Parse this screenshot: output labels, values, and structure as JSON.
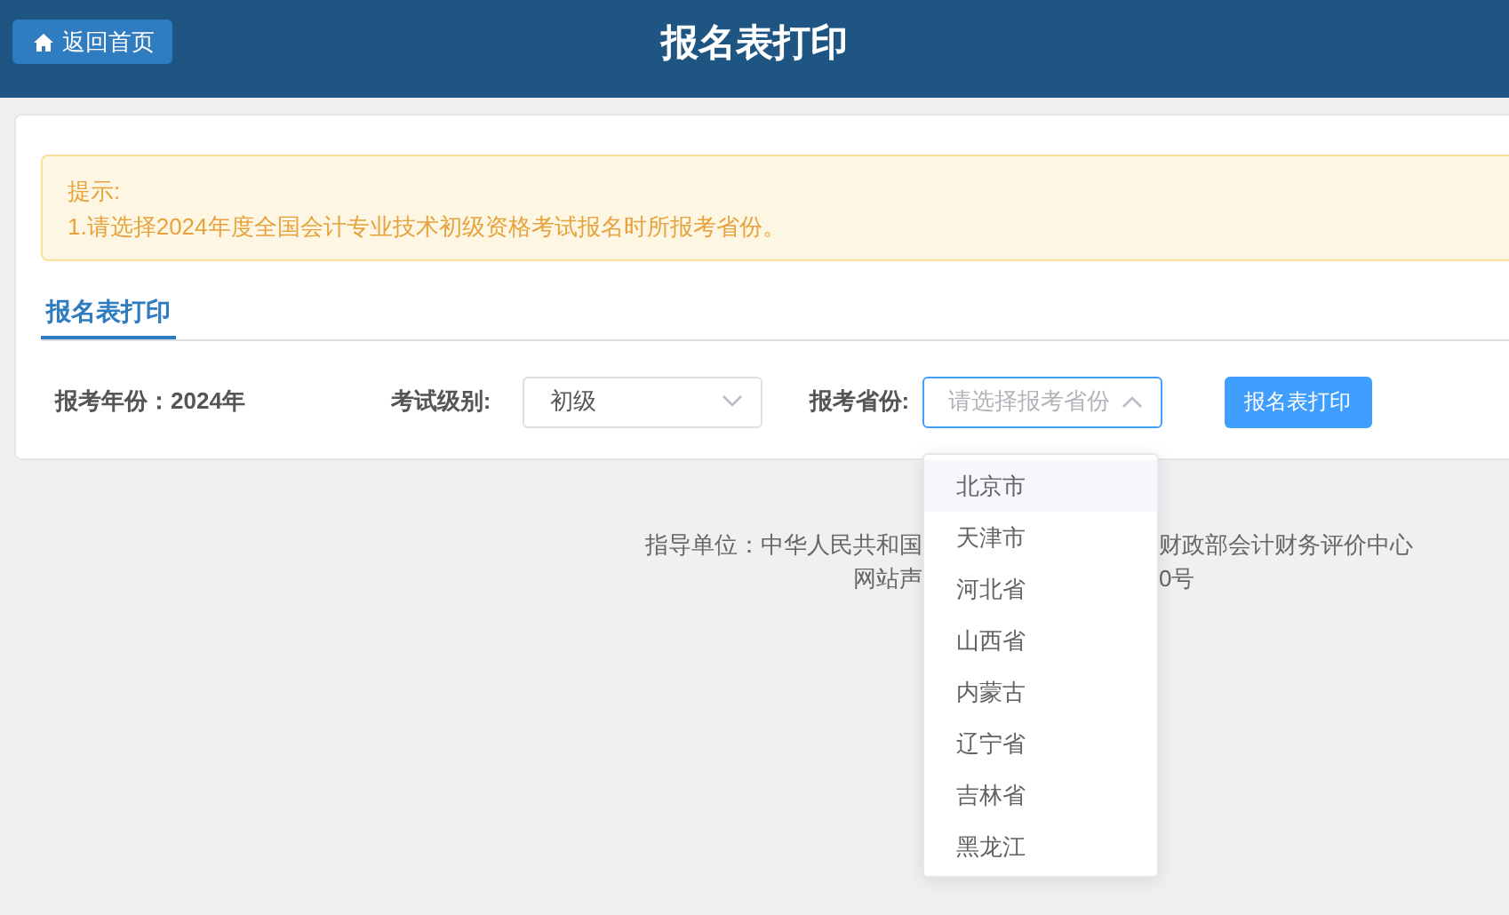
{
  "header": {
    "home_button": "返回首页",
    "title": "报名表打印"
  },
  "notice": {
    "title": "提示:",
    "lines": [
      "1.请选择2024年度全国会计专业技术初级资格考试报名时所报考省份。"
    ]
  },
  "tabs": [
    {
      "label": "报名表打印",
      "selected": true
    }
  ],
  "form": {
    "year_label": "报考年份：",
    "year_value": "2024年",
    "level": {
      "label": "考试级别:",
      "value": "初级",
      "open": false
    },
    "province": {
      "label": "报考省份:",
      "placeholder": "请选择报考省份",
      "open": true
    },
    "print_button": "报名表打印"
  },
  "province_options": [
    {
      "label": "北京市",
      "hovered": true
    },
    {
      "label": "天津市",
      "hovered": false
    },
    {
      "label": "河北省",
      "hovered": false
    },
    {
      "label": "山西省",
      "hovered": false
    },
    {
      "label": "内蒙古",
      "hovered": false
    },
    {
      "label": "辽宁省",
      "hovered": false
    },
    {
      "label": "吉林省",
      "hovered": false
    },
    {
      "label": "黑龙江",
      "hovered": false
    }
  ],
  "footer": {
    "lines": [
      {
        "left": "指导单位：中华人民共和国",
        "right": "财政部会计财务评价中心"
      },
      {
        "left": "网站声",
        "right": "0号"
      }
    ]
  }
}
